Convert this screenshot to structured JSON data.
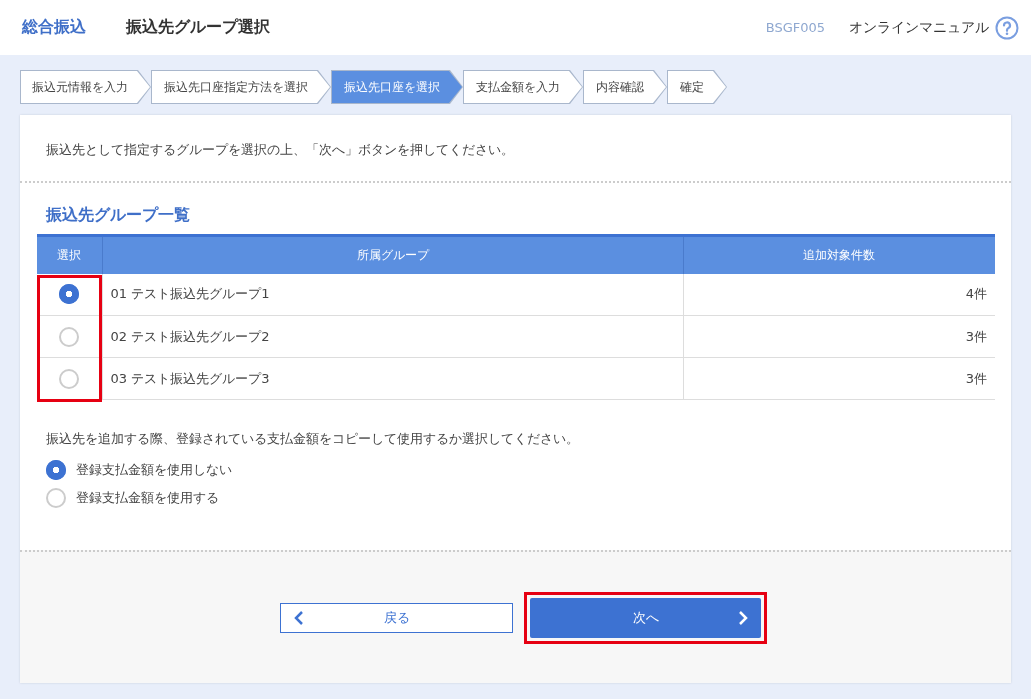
{
  "header": {
    "category": "総合振込",
    "title": "振込先グループ選択",
    "screen_id": "BSGF005",
    "manual_link": "オンラインマニュアル"
  },
  "steps": [
    {
      "label": "振込元情報を入力",
      "selected": false
    },
    {
      "label": "振込先口座指定方法を選択",
      "selected": false
    },
    {
      "label": "振込先口座を選択",
      "selected": true
    },
    {
      "label": "支払金額を入力",
      "selected": false
    },
    {
      "label": "内容確認",
      "selected": false
    },
    {
      "label": "確定",
      "selected": false
    }
  ],
  "instruction": "振込先として指定するグループを選択の上、「次へ」ボタンを押してください。",
  "section_title": "振込先グループ一覧",
  "table": {
    "columns": [
      "選択",
      "所属グループ",
      "追加対象件数"
    ],
    "rows": [
      {
        "group": "01 テスト振込先グループ1",
        "count": "4件",
        "selected": true
      },
      {
        "group": "02 テスト振込先グループ2",
        "count": "3件",
        "selected": false
      },
      {
        "group": "03 テスト振込先グループ3",
        "count": "3件",
        "selected": false
      }
    ]
  },
  "copy_question": "振込先を追加する際、登録されている支払金額をコピーして使用するか選択してください。",
  "copy_options": [
    {
      "label": "登録支払金額を使用しない",
      "selected": true
    },
    {
      "label": "登録支払金額を使用する",
      "selected": false
    }
  ],
  "buttons": {
    "back": "戻る",
    "next": "次へ"
  }
}
